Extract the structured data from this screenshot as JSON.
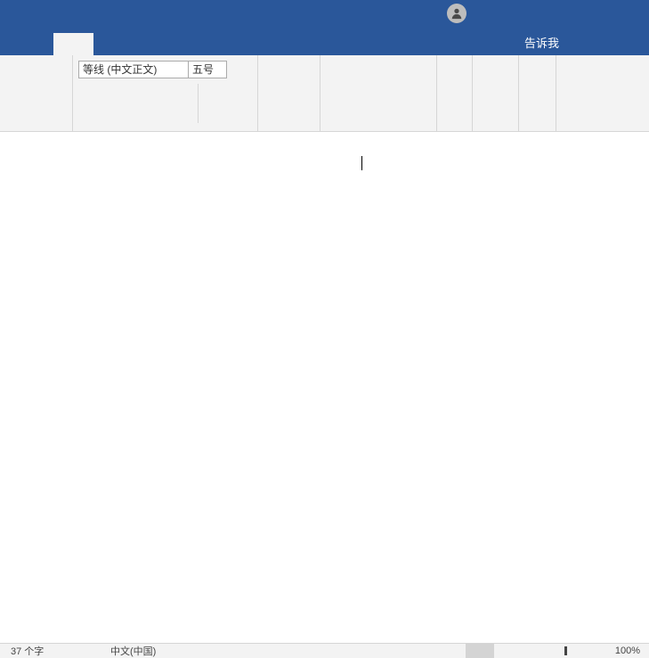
{
  "header": {
    "tell_me": "告诉我"
  },
  "ribbon": {
    "font_name": "等线 (中文正文)",
    "font_size": "五号"
  },
  "statusbar": {
    "word_count": "37 个字",
    "language": "中文(中国)",
    "zoom": "100%"
  }
}
